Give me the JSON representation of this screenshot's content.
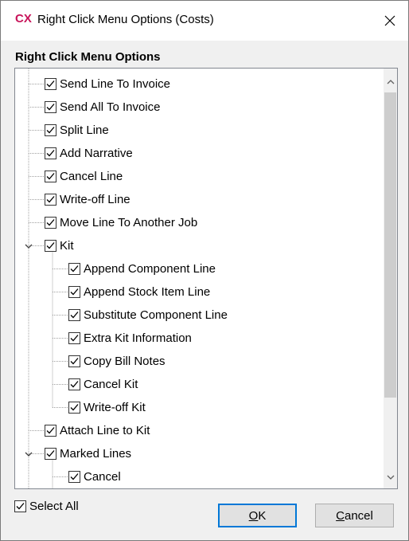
{
  "titlebar": {
    "icon_text": "CX",
    "title": "Right Click Menu Options (Costs)",
    "close_icon": "close-icon"
  },
  "group_label": "Right Click Menu Options",
  "tree": {
    "items": [
      {
        "label": "Send Line To Invoice",
        "checked": true,
        "level": 0
      },
      {
        "label": "Send All To Invoice",
        "checked": true,
        "level": 0
      },
      {
        "label": "Split Line",
        "checked": true,
        "level": 0
      },
      {
        "label": "Add Narrative",
        "checked": true,
        "level": 0
      },
      {
        "label": "Cancel Line",
        "checked": true,
        "level": 0
      },
      {
        "label": "Write-off Line",
        "checked": true,
        "level": 0
      },
      {
        "label": "Move Line To Another Job",
        "checked": true,
        "level": 0
      },
      {
        "label": "Kit",
        "checked": true,
        "level": 0,
        "expanded": true
      },
      {
        "label": "Append Component Line",
        "checked": true,
        "level": 1
      },
      {
        "label": "Append Stock Item Line",
        "checked": true,
        "level": 1
      },
      {
        "label": "Substitute Component Line",
        "checked": true,
        "level": 1
      },
      {
        "label": "Extra Kit Information",
        "checked": true,
        "level": 1
      },
      {
        "label": "Copy Bill Notes",
        "checked": true,
        "level": 1
      },
      {
        "label": "Cancel Kit",
        "checked": true,
        "level": 1
      },
      {
        "label": "Write-off Kit",
        "checked": true,
        "level": 1
      },
      {
        "label": "Attach Line to Kit",
        "checked": true,
        "level": 0
      },
      {
        "label": "Marked Lines",
        "checked": true,
        "level": 0,
        "expanded": true
      },
      {
        "label": "Cancel",
        "checked": true,
        "level": 1
      }
    ]
  },
  "select_all": {
    "label": "Select All",
    "checked": true
  },
  "buttons": {
    "ok_accel": "O",
    "ok_rest": "K",
    "cancel_accel": "C",
    "cancel_rest": "ancel"
  },
  "colors": {
    "icon": "#c8145a",
    "default_button_border": "#0078d7"
  }
}
